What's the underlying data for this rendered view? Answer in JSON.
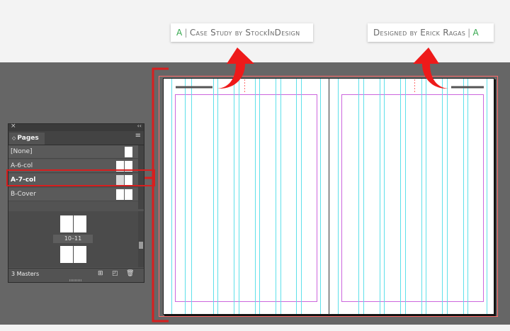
{
  "labels": {
    "left": {
      "mark": "A",
      "sep": "|",
      "text": "Case Study by StockInDesign"
    },
    "right": {
      "text": "Designed by Erick Ragas",
      "sep": "|",
      "mark": "A"
    }
  },
  "colors": {
    "accent_green": "#35a84e",
    "annotation_red": "#d71f1f",
    "guide_cyan": "#5ee0ea",
    "margin_magenta": "#cc66dd",
    "bleed_red": "#ff6b6b"
  },
  "panel": {
    "close_icon": "×",
    "collapse_icon": "‹‹",
    "tab_icon": "◇",
    "tab_label": "Pages",
    "menu_icon": "≡",
    "masters": [
      {
        "name": "[None]"
      },
      {
        "name": "A-6-col"
      },
      {
        "name": "A-7-col",
        "selected": true
      },
      {
        "name": "B-Cover"
      }
    ],
    "page_label": "10–11",
    "footer": {
      "masters_count": "3 Masters",
      "icons": [
        "page-size-icon",
        "new-page-icon",
        "delete-page-icon"
      ]
    }
  }
}
